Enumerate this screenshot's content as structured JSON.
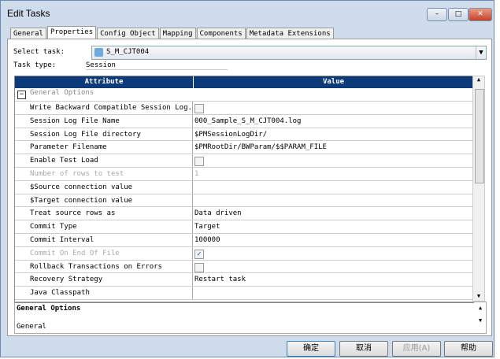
{
  "window": {
    "title": "Edit Tasks",
    "minimize": "–",
    "maximize": "□",
    "close": "✕"
  },
  "tabs": [
    "General",
    "Properties",
    "Config Object",
    "Mapping",
    "Components",
    "Metadata Extensions"
  ],
  "select_task": {
    "label": "Select task:",
    "value": "S_M_CJT004"
  },
  "task_type": {
    "label": "Task type:",
    "value": "Session"
  },
  "grid": {
    "headers": [
      "Attribute",
      "Value"
    ],
    "group": "General Options",
    "rows": [
      {
        "attr": "Write Backward Compatible Session Log...",
        "value": "",
        "checkbox": false,
        "disabled": false
      },
      {
        "attr": "Session Log File Name",
        "value": "000_Sample_S_M_CJT004.log",
        "disabled": false
      },
      {
        "attr": "Session Log File directory",
        "value": "$PMSessionLogDir/",
        "disabled": false
      },
      {
        "attr": "Parameter Filename",
        "value": "$PMRootDir/BWParam/$$PARAM_FILE",
        "disabled": false
      },
      {
        "attr": "Enable Test Load",
        "value": "",
        "checkbox": false,
        "disabled": false
      },
      {
        "attr": "Number of rows to test",
        "value": "1",
        "disabled": true
      },
      {
        "attr": "$Source connection value",
        "value": "",
        "disabled": false
      },
      {
        "attr": "$Target connection value",
        "value": "",
        "disabled": false
      },
      {
        "attr": "Treat source rows as",
        "value": "Data driven",
        "disabled": false
      },
      {
        "attr": "Commit Type",
        "value": "Target",
        "disabled": false
      },
      {
        "attr": "Commit Interval",
        "value": "100000",
        "disabled": false
      },
      {
        "attr": "Commit On End Of File",
        "value": "",
        "checkbox": true,
        "disabled": true
      },
      {
        "attr": "Rollback Transactions on Errors",
        "value": "",
        "checkbox": false,
        "disabled": false
      },
      {
        "attr": "Recovery Strategy",
        "value": "Restart task",
        "disabled": false
      },
      {
        "attr": "Java Classpath",
        "value": "",
        "disabled": false
      }
    ]
  },
  "description": {
    "title": "General Options",
    "body": "General"
  },
  "buttons": {
    "ok": "确定",
    "cancel": "取消",
    "apply": "应用(A)",
    "help": "帮助"
  }
}
